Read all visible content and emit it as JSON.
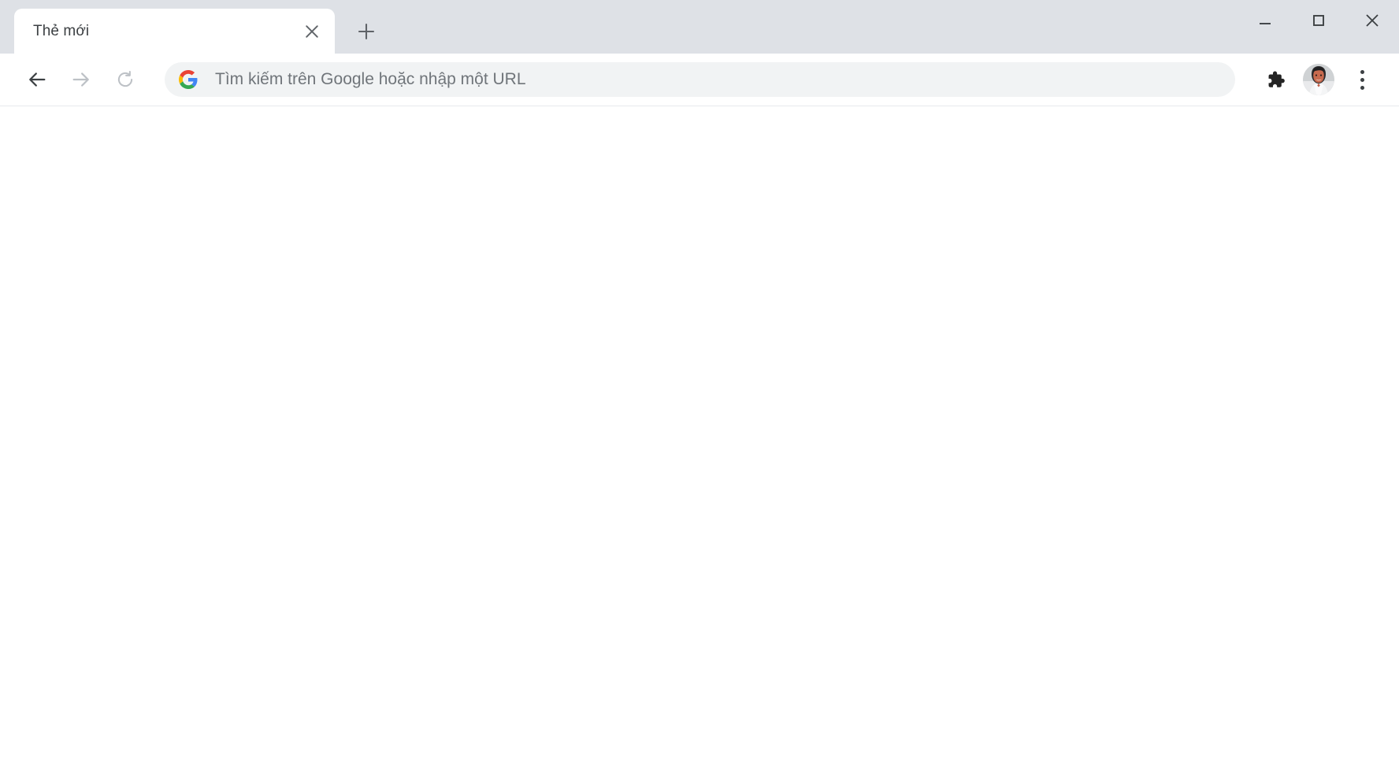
{
  "window": {
    "tab_strip_color": "#dee1e6",
    "controls": {
      "minimize_label": "Thu nhỏ",
      "maximize_label": "Phóng to",
      "close_label": "Đóng"
    }
  },
  "tabs": [
    {
      "title": "Thẻ mới",
      "active": true,
      "close_label": "Đóng thẻ"
    }
  ],
  "new_tab_button": {
    "label": "Thẻ mới",
    "icon": "plus-icon"
  },
  "toolbar": {
    "back": {
      "label": "Quay lại",
      "icon": "arrow-left-icon",
      "enabled": true
    },
    "forward": {
      "label": "Chuyển tiếp",
      "icon": "arrow-right-icon",
      "enabled": false
    },
    "reload": {
      "label": "Tải lại trang này",
      "icon": "reload-icon",
      "enabled": false
    },
    "extensions": {
      "label": "Tiện ích",
      "icon": "puzzle-icon"
    },
    "profile": {
      "label": "Hồ sơ",
      "icon": "avatar"
    },
    "menu": {
      "label": "Tùy chỉnh và kiểm soát Google Chrome",
      "icon": "three-dots-icon"
    }
  },
  "omnibox": {
    "value": "",
    "placeholder": "Tìm kiếm trên Google hoặc nhập một URL",
    "leading_icon": "google-g-icon",
    "background": "#f1f3f4",
    "text_color": "#70757a"
  },
  "page": {
    "content": "",
    "background": "#ffffff"
  }
}
